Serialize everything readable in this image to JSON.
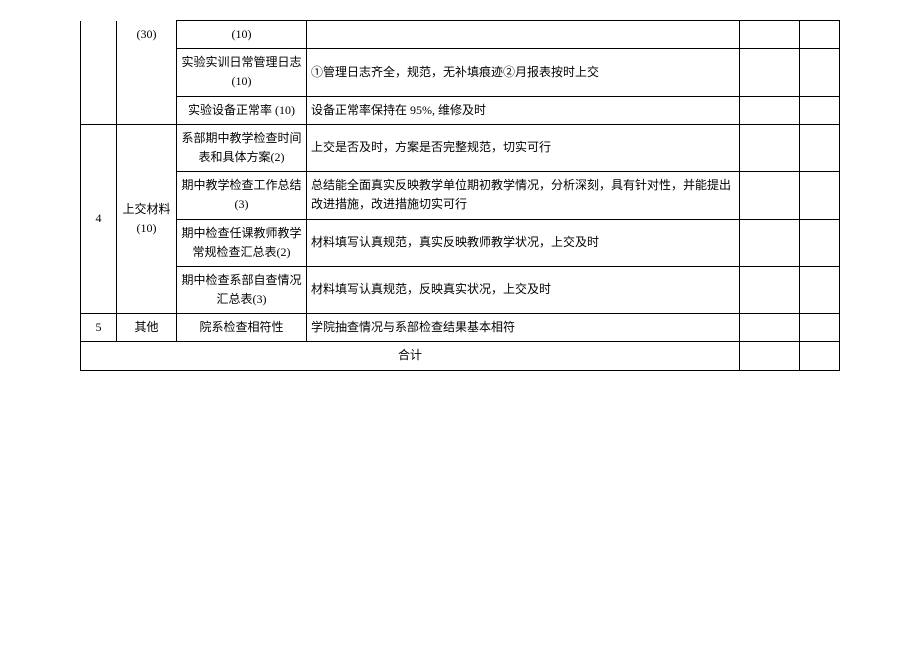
{
  "rows": {
    "r1": {
      "cat_score": "(30)",
      "item": "(10)"
    },
    "r2": {
      "item": "实验实训日常管理日志 (10)",
      "desc": "①管理日志齐全，规范，无补填痕迹②月报表按时上交"
    },
    "r3": {
      "item": "实验设备正常率 (10)",
      "desc": "设备正常率保持在 95%, 维修及时"
    },
    "group4": {
      "idx": "4",
      "cat": "上交材料 (10)"
    },
    "r4": {
      "item": "系部期中教学检查时间表和具体方案(2)",
      "desc": "上交是否及时，方案是否完整规范，切实可行"
    },
    "r5": {
      "item": "期中教学检查工作总结 (3)",
      "desc": "总结能全面真实反映教学单位期初教学情况，分析深刻，具有针对性，并能提出改进措施，改进措施切实可行"
    },
    "r6": {
      "item": "期中检查任课教师教学常规检查汇总表(2)",
      "desc": "材料填写认真规范，真实反映教师教学状况，上交及时"
    },
    "r7": {
      "item": "期中检查系部自查情况汇总表(3)",
      "desc": "材料填写认真规范，反映真实状况，上交及时"
    },
    "r8": {
      "idx": "5",
      "cat": "其他",
      "item": "院系检查相符性",
      "desc": "学院抽查情况与系部检查结果基本相符"
    },
    "total": "合计"
  }
}
